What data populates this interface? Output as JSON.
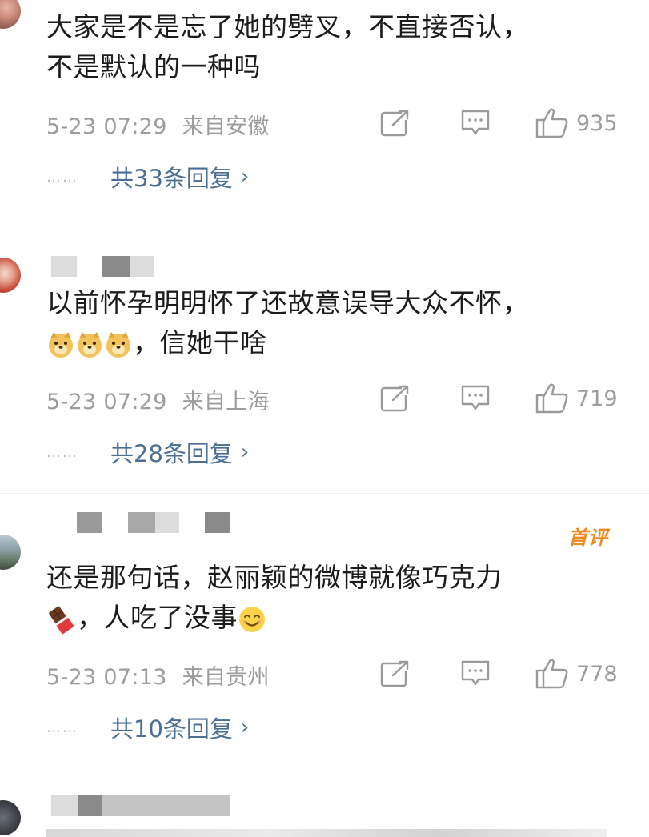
{
  "comments": [
    {
      "text_lines": [
        "大家是不是忘了她的劈叉，不直接否认，",
        "不是默认的一种吗"
      ],
      "timestamp": "5-23 07:29",
      "location": "来自安徽",
      "likes": "935",
      "replies_label": "共33条回复"
    },
    {
      "text_lines": [
        "以前怀孕明明怀了还故意误导大众不怀，",
        "，信她干啥"
      ],
      "timestamp": "5-23 07:29",
      "location": "来自上海",
      "likes": "719",
      "replies_label": "共28条回复"
    },
    {
      "badge": "首评",
      "text_lines": [
        "还是那句话，赵丽颖的微博就像巧克力",
        "，人吃了没事"
      ],
      "timestamp": "5-23 07:13",
      "location": "来自贵州",
      "likes": "778",
      "replies_label": "共10条回复"
    }
  ],
  "icons": {
    "repost": "repost-icon",
    "comment": "comment-icon",
    "like": "thumbs-up-icon",
    "chevron": "chevron-right-icon",
    "emoji_doge": "doge-emoji-icon",
    "emoji_chocolate": "chocolate-emoji-icon",
    "emoji_smile": "smile-emoji-icon"
  },
  "colors": {
    "text": "#1c1c1c",
    "meta": "#9c9c9c",
    "link": "#4a6e94",
    "badge": "#f08a1f",
    "divider": "#eeeeee"
  }
}
